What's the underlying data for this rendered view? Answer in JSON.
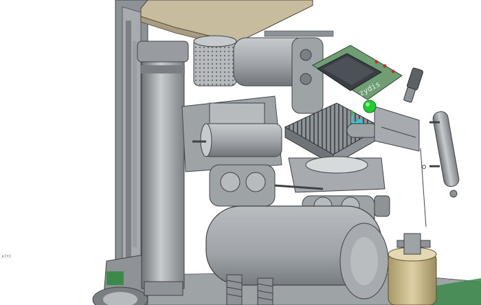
{
  "viewport": {
    "background": "#ffffff",
    "coordinate_readout": "x(+)",
    "pcb_marking": "zydis"
  },
  "colors": {
    "metal_dark": "#6f7478",
    "metal_mid": "#a4a8ac",
    "metal_light": "#c8cbcd",
    "cover_tan": "#c8bc9e",
    "pcb_green": "#6f9e74",
    "chip_dark": "#3a3f44",
    "green_led": "#22cc33",
    "cyan_marker": "#20d0e0",
    "brass": "#c9b98b"
  },
  "parts": [
    "chassis-frame",
    "top-cover-plate",
    "vertical-cylinder",
    "motor-housing",
    "pcb-board",
    "connector-plug",
    "heatsink",
    "green-button",
    "side-tube",
    "horizontal-cylinder",
    "pump-housing",
    "tank",
    "filter-canister",
    "springs",
    "base-plate"
  ]
}
